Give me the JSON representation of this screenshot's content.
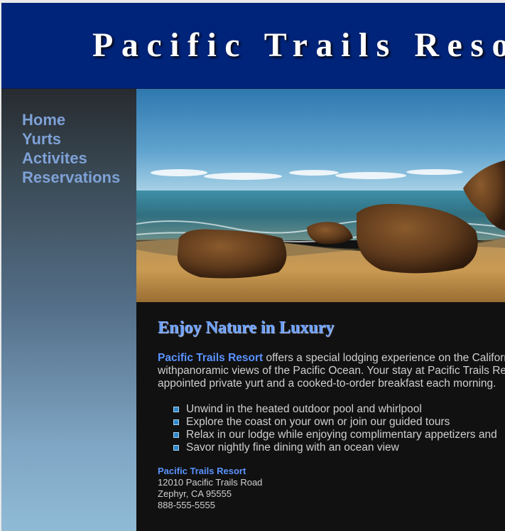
{
  "header": {
    "title": "Pacific Trails Resort"
  },
  "nav": {
    "items": [
      {
        "label": "Home"
      },
      {
        "label": "Yurts"
      },
      {
        "label": "Activites"
      },
      {
        "label": "Reservations"
      }
    ]
  },
  "hero": {
    "image_alt": "coastal beach with rocks"
  },
  "main": {
    "heading": "Enjoy Nature in Luxury",
    "intro_brand": "Pacific Trails Resort",
    "intro_line1": " offers a special lodging experience on the California",
    "intro_line2": "withpanoramic views of the Pacific Ocean. Your stay at Pacific Trails Resort",
    "intro_line3": "appointed private yurt and a cooked-to-order breakfast each morning.",
    "features": [
      "Unwind in the heated outdoor pool and whirlpool",
      "Explore the coast on your own or join our guided tours",
      "Relax in our lodge while enjoying complimentary appetizers and",
      "Savor nightly fine dining with an ocean view"
    ],
    "address": {
      "name": "Pacific Trails Resort",
      "street": "12010 Pacific Trails Road",
      "city": "Zephyr, CA 95555",
      "phone": "888-555-5555"
    }
  },
  "colors": {
    "header_bg": "#00247a",
    "nav_link": "#7ea1d6",
    "brand_blue": "#5a93ff",
    "content_bg": "#111111"
  }
}
